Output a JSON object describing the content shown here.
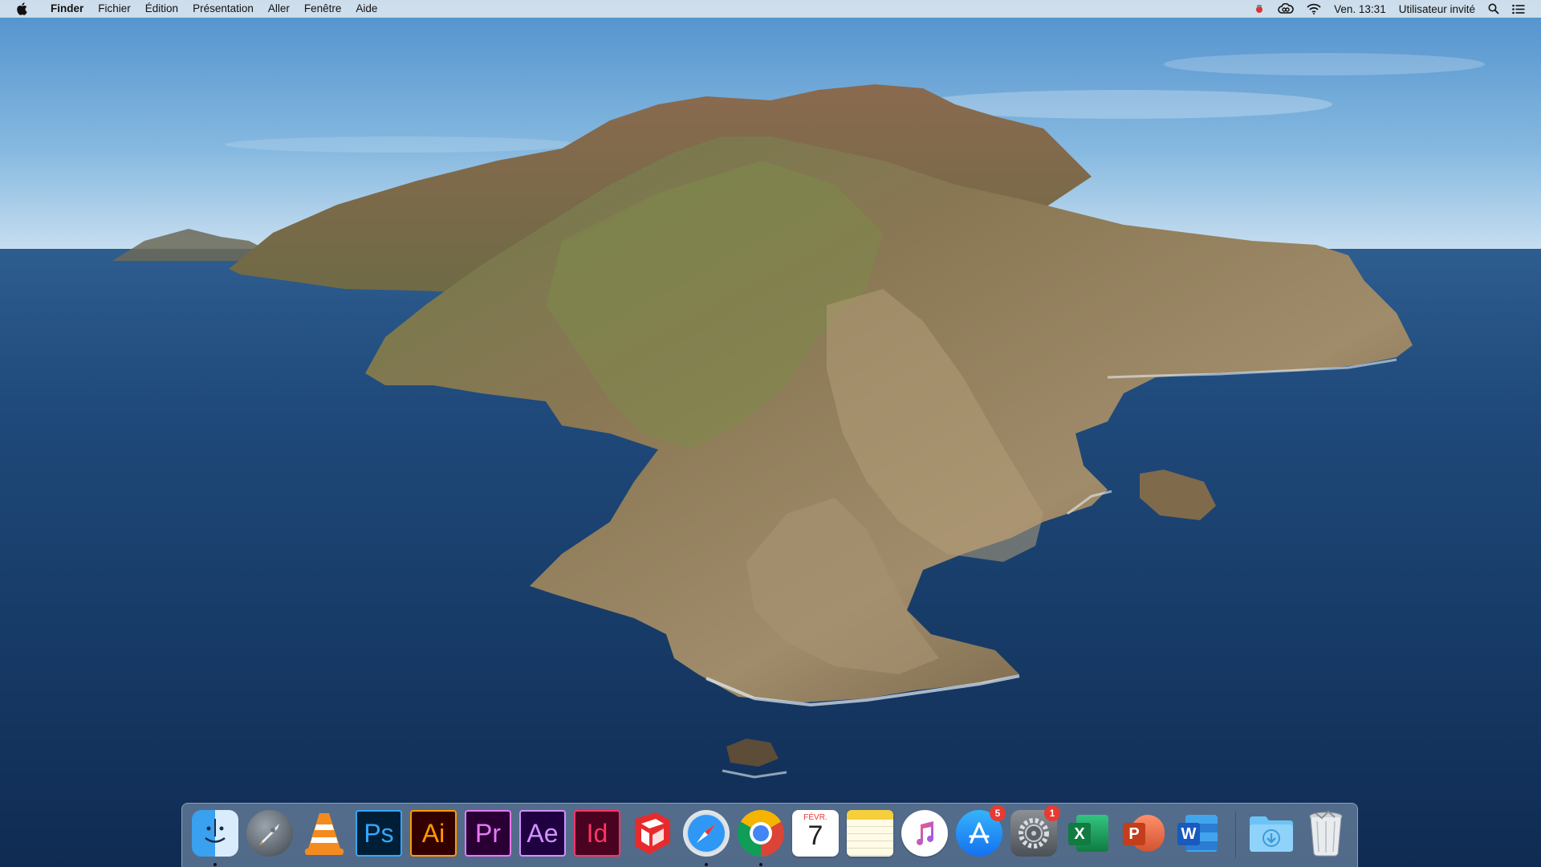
{
  "menubar": {
    "app_name": "Finder",
    "items": [
      "Fichier",
      "Édition",
      "Présentation",
      "Aller",
      "Fenêtre",
      "Aide"
    ],
    "clock": "Ven. 13:31",
    "user": "Utilisateur invité"
  },
  "dock": {
    "items": [
      {
        "name": "Finder",
        "icon": "finder-icon",
        "running": true
      },
      {
        "name": "Launchpad",
        "icon": "launchpad-icon"
      },
      {
        "name": "VLC",
        "icon": "vlc-icon"
      },
      {
        "name": "Photoshop",
        "icon": "photoshop-icon",
        "label": "Ps",
        "bg": "#001e36",
        "fg": "#31a8ff"
      },
      {
        "name": "Illustrator",
        "icon": "illustrator-icon",
        "label": "Ai",
        "bg": "#330000",
        "fg": "#ff9a00"
      },
      {
        "name": "Premiere",
        "icon": "premiere-icon",
        "label": "Pr",
        "bg": "#2a0034",
        "fg": "#ea77ff"
      },
      {
        "name": "After Effects",
        "icon": "after-effects-icon",
        "label": "Ae",
        "bg": "#1f0040",
        "fg": "#d291ff"
      },
      {
        "name": "InDesign",
        "icon": "indesign-icon",
        "label": "Id",
        "bg": "#49021f",
        "fg": "#ff3366"
      },
      {
        "name": "SketchUp",
        "icon": "sketchup-icon"
      },
      {
        "name": "Safari",
        "icon": "safari-icon",
        "running": true
      },
      {
        "name": "Chrome",
        "icon": "chrome-icon",
        "running": true
      },
      {
        "name": "Calendar",
        "icon": "calendar-icon",
        "month": "FÉVR.",
        "day": "7"
      },
      {
        "name": "Notes",
        "icon": "notes-icon"
      },
      {
        "name": "iTunes",
        "icon": "itunes-icon"
      },
      {
        "name": "App Store",
        "icon": "app-store-icon",
        "badge": "5"
      },
      {
        "name": "System Preferences",
        "icon": "system-preferences-icon",
        "badge": "1"
      },
      {
        "name": "Excel",
        "icon": "excel-icon",
        "label": "X"
      },
      {
        "name": "PowerPoint",
        "icon": "powerpoint-icon",
        "label": "P"
      },
      {
        "name": "Word",
        "icon": "word-icon",
        "label": "W"
      },
      {
        "name": "Downloads",
        "icon": "downloads-folder-icon"
      },
      {
        "name": "Trash",
        "icon": "trash-icon"
      }
    ]
  },
  "colors": {
    "accent_badge": "#e63a32",
    "sea": "#163a66",
    "sky": "#7fb2dd"
  }
}
